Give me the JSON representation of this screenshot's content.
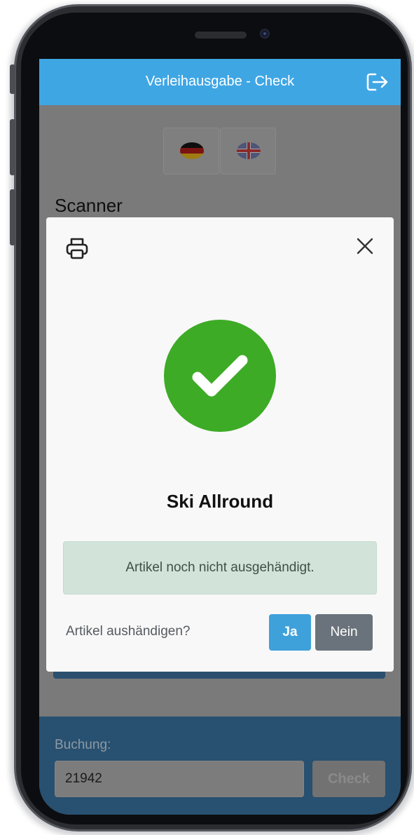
{
  "app": {
    "title": "Verleihausgabe - Check",
    "logout_icon": "logout-icon"
  },
  "language": {
    "options": [
      {
        "code": "de",
        "icon": "flag-germany-icon"
      },
      {
        "code": "en",
        "icon": "flag-uk-icon"
      }
    ]
  },
  "scanner": {
    "heading": "Scanner"
  },
  "modal": {
    "print_icon": "print-icon",
    "close_icon": "close-icon",
    "status_icon": "checkmark-icon",
    "status_color": "#3dab26",
    "item_name": "Ski Allround",
    "alert_text": "Artikel noch nicht ausgehändigt.",
    "question": "Artikel aushändigen?",
    "yes_label": "Ja",
    "no_label": "Nein"
  },
  "booking": {
    "label": "Buchung:",
    "value": "21942",
    "check_label": "Check"
  },
  "colors": {
    "header": "#3fa6e4",
    "booking_bar": "#285070",
    "yes_button": "#3ea1da",
    "no_button": "#6a737b",
    "alert_bg": "#d2e4da"
  }
}
